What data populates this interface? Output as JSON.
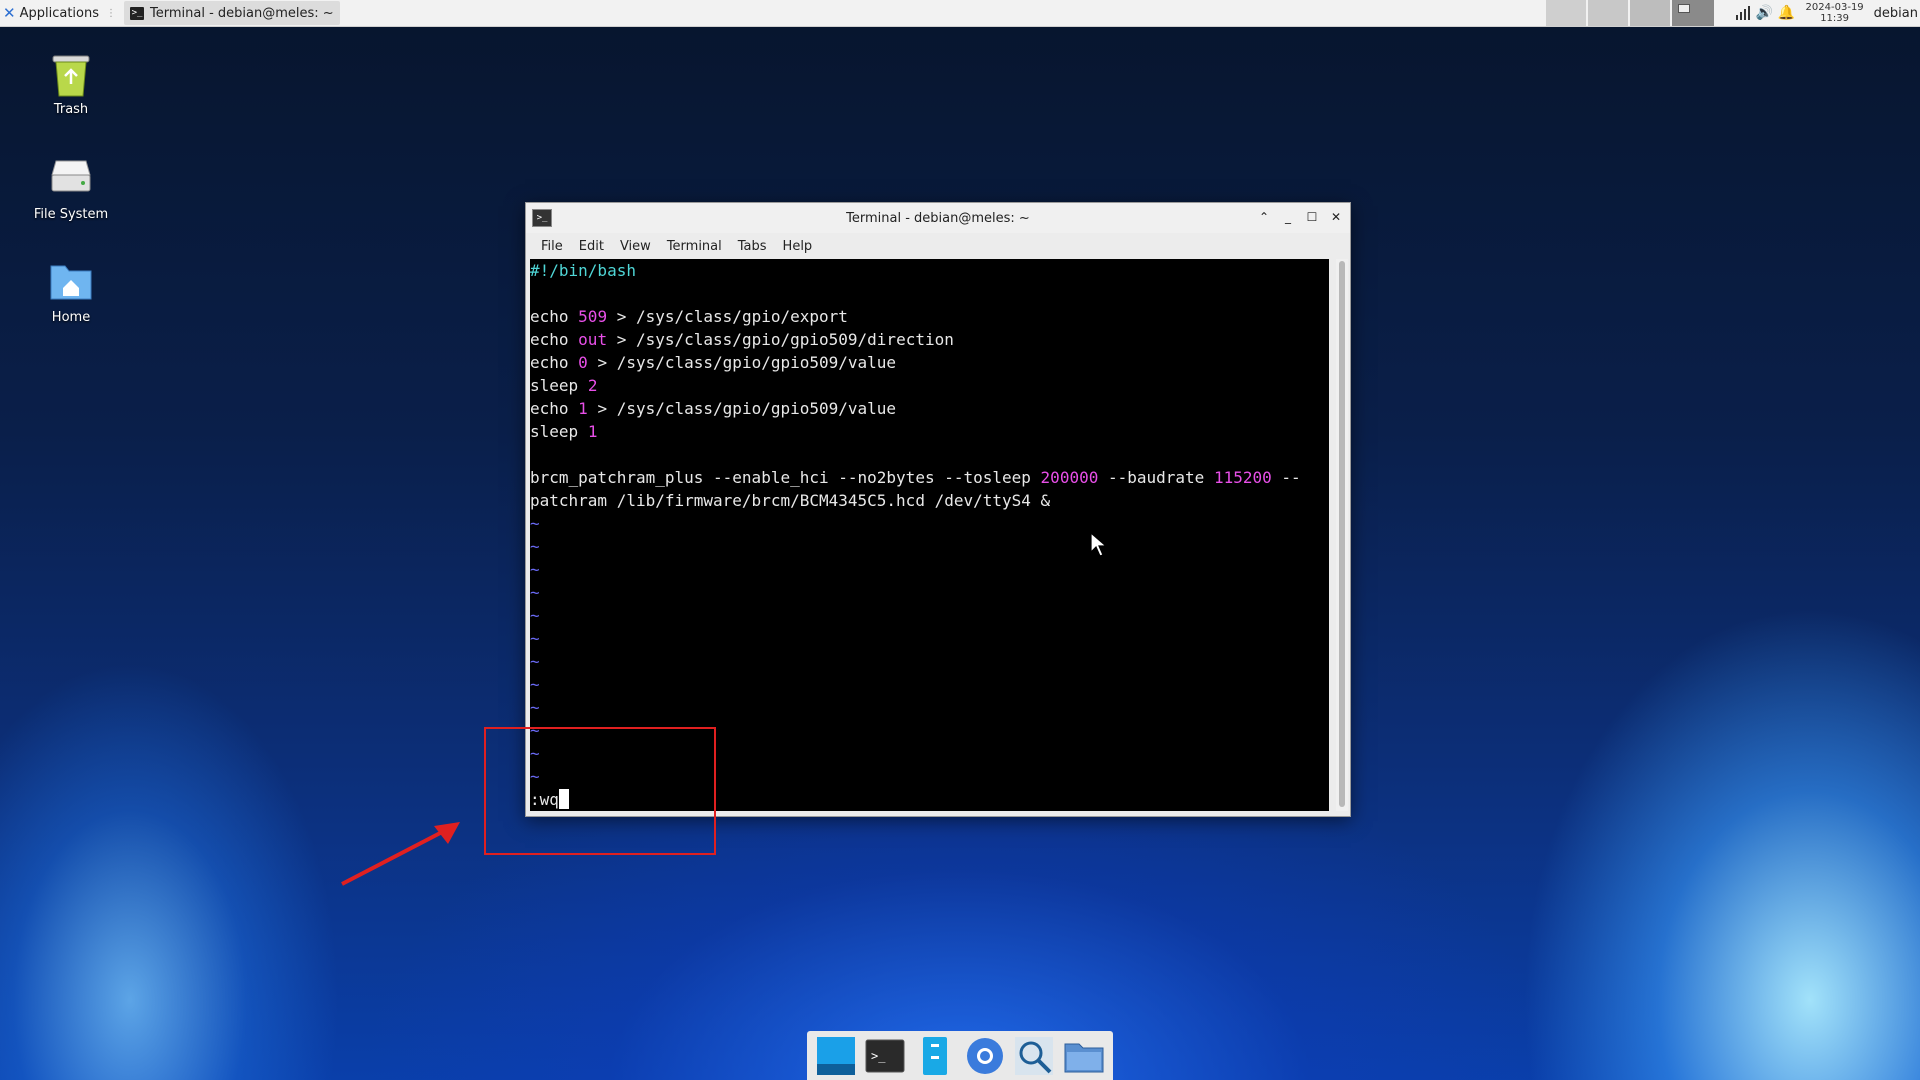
{
  "panel": {
    "applications_label": "Applications",
    "task_label": "Terminal - debian@meles: ~",
    "clock_date": "2024-03-19",
    "clock_time": "11:39",
    "user": "debian"
  },
  "desktop": {
    "icons": [
      {
        "label": "Trash",
        "icon": "trash-icon"
      },
      {
        "label": "File System",
        "icon": "drive-icon"
      },
      {
        "label": "Home",
        "icon": "home-folder-icon"
      }
    ]
  },
  "window": {
    "title": "Terminal - debian@meles: ~",
    "menu": [
      "File",
      "Edit",
      "View",
      "Terminal",
      "Tabs",
      "Help"
    ]
  },
  "terminal": {
    "shebang": "#!/bin/bash",
    "l1": {
      "cmd": "echo",
      "val": "509",
      "rest": " > /sys/class/gpio/export"
    },
    "l2": {
      "cmd": "echo",
      "val": "out",
      "rest": " > /sys/class/gpio/gpio509/direction"
    },
    "l3": {
      "cmd": "echo",
      "val": "0",
      "rest": " > /sys/class/gpio/gpio509/value"
    },
    "l4": {
      "cmd": "sleep",
      "val": "2"
    },
    "l5": {
      "cmd": "echo",
      "val": "1",
      "rest": " > /sys/class/gpio/gpio509/value"
    },
    "l6": {
      "cmd": "sleep",
      "val": "1"
    },
    "l7": {
      "a": "brcm_patchram_plus --enable_hci --no2bytes --tosleep ",
      "b": "200000",
      "c": " --baudrate ",
      "d": "115200",
      "e": " --"
    },
    "l8": "patchram /lib/firmware/brcm/BCM4345C5.hcd /dev/ttyS4 &",
    "tilde": "~",
    "command": ":wq"
  },
  "dock": {
    "items": [
      "show-desktop-icon",
      "terminal-icon",
      "file-manager-icon",
      "browser-icon",
      "search-icon",
      "folder-icon"
    ]
  },
  "colors": {
    "annotation": "#e02020",
    "shebang": "#4fd6d6",
    "number": "#e84fe8",
    "tilde": "#6a6af7"
  }
}
